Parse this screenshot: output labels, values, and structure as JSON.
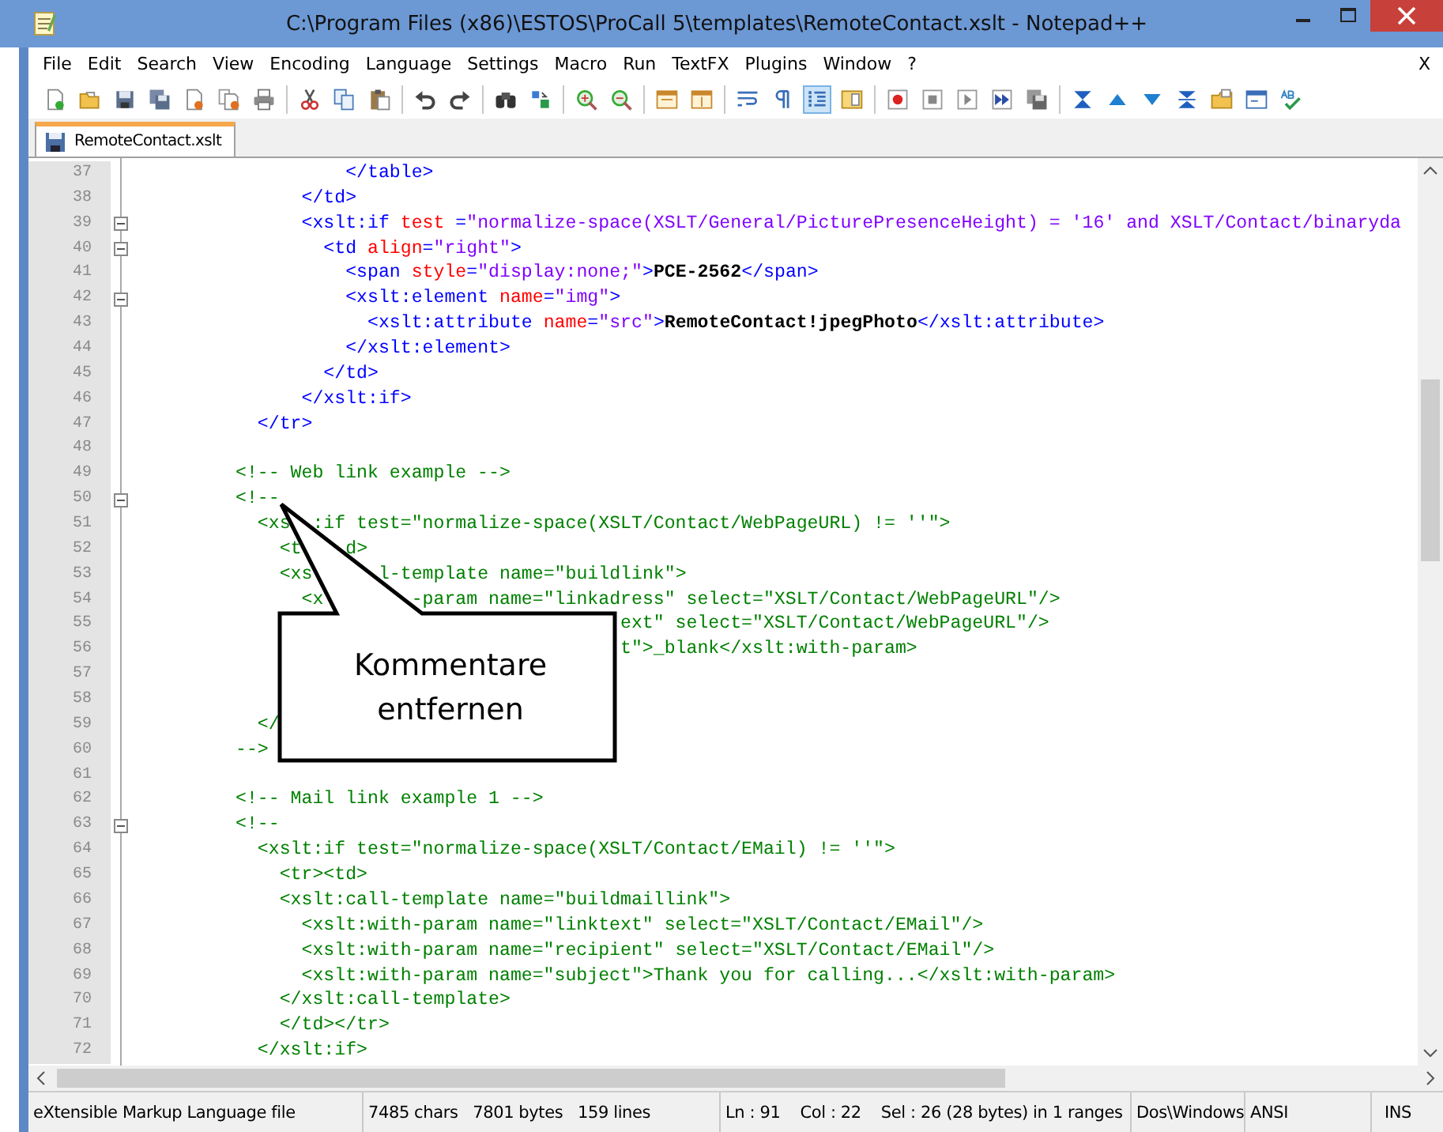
{
  "window": {
    "title": "C:\\Program Files (x86)\\ESTOS\\ProCall 5\\templates\\RemoteContact.xslt - Notepad++"
  },
  "menu": [
    "File",
    "Edit",
    "Search",
    "View",
    "Encoding",
    "Language",
    "Settings",
    "Macro",
    "Run",
    "TextFX",
    "Plugins",
    "Window",
    "?"
  ],
  "menu_close": "X",
  "toolbar": [
    {
      "kind": "new",
      "pressed": false
    },
    {
      "kind": "open",
      "pressed": false
    },
    {
      "kind": "save",
      "pressed": false
    },
    {
      "kind": "saveall",
      "pressed": false
    },
    {
      "kind": "close",
      "pressed": false
    },
    {
      "kind": "closeall",
      "pressed": false
    },
    {
      "kind": "print",
      "pressed": false
    },
    {
      "kind": "sep"
    },
    {
      "kind": "cut",
      "pressed": false
    },
    {
      "kind": "copy",
      "pressed": false
    },
    {
      "kind": "paste",
      "pressed": false
    },
    {
      "kind": "sep"
    },
    {
      "kind": "undo",
      "pressed": false
    },
    {
      "kind": "redo",
      "pressed": false
    },
    {
      "kind": "sep"
    },
    {
      "kind": "find",
      "pressed": false
    },
    {
      "kind": "replace",
      "pressed": false
    },
    {
      "kind": "sep"
    },
    {
      "kind": "zoomin",
      "pressed": false
    },
    {
      "kind": "zoomout",
      "pressed": false
    },
    {
      "kind": "sep"
    },
    {
      "kind": "syncv",
      "pressed": false
    },
    {
      "kind": "synch",
      "pressed": false
    },
    {
      "kind": "sep"
    },
    {
      "kind": "wrap",
      "pressed": false
    },
    {
      "kind": "pilcrow",
      "pressed": false
    },
    {
      "kind": "indent",
      "pressed": true
    },
    {
      "kind": "docmap",
      "pressed": false
    },
    {
      "kind": "sep"
    },
    {
      "kind": "record",
      "pressed": false
    },
    {
      "kind": "stop",
      "pressed": false
    },
    {
      "kind": "play",
      "pressed": false
    },
    {
      "kind": "playmulti",
      "pressed": false
    },
    {
      "kind": "savemacro",
      "pressed": false
    },
    {
      "kind": "sep"
    },
    {
      "kind": "foldall",
      "pressed": false
    },
    {
      "kind": "up",
      "pressed": false
    },
    {
      "kind": "down",
      "pressed": false
    },
    {
      "kind": "unfoldall",
      "pressed": false
    },
    {
      "kind": "folder",
      "pressed": false
    },
    {
      "kind": "panel",
      "pressed": false
    },
    {
      "kind": "spell",
      "pressed": false
    }
  ],
  "tabs": [
    {
      "label": "RemoteContact.xslt",
      "selected": true
    }
  ],
  "editor": {
    "lines": [
      {
        "number": "37",
        "foldable": false,
        "segments": [
          {
            "kind": "tag",
            "text": "          </table>"
          }
        ]
      },
      {
        "number": "38",
        "foldable": false,
        "segments": [
          {
            "kind": "tag",
            "text": "      </td>"
          }
        ]
      },
      {
        "number": "39",
        "foldable": true,
        "segments": [
          {
            "kind": "tag",
            "text": "      <xslt:if"
          },
          {
            "kind": "attr",
            "text": " test"
          },
          {
            "kind": "tag",
            "text": " ="
          },
          {
            "kind": "string",
            "text": "\"normalize-space(XSLT/General/PicturePresenceHeight) = '16' and XSLT/Contact/binaryda"
          }
        ]
      },
      {
        "number": "40",
        "foldable": true,
        "segments": [
          {
            "kind": "tag",
            "text": "        <td"
          },
          {
            "kind": "attr",
            "text": " align"
          },
          {
            "kind": "tag",
            "text": "="
          },
          {
            "kind": "string",
            "text": "\"right\""
          },
          {
            "kind": "tag",
            "text": ">"
          }
        ]
      },
      {
        "number": "41",
        "foldable": false,
        "segments": [
          {
            "kind": "tag",
            "text": "          <span"
          },
          {
            "kind": "attr",
            "text": " style"
          },
          {
            "kind": "tag",
            "text": "="
          },
          {
            "kind": "string",
            "text": "\"display:none;\""
          },
          {
            "kind": "tag",
            "text": ">"
          },
          {
            "kind": "text",
            "text": "PCE-2562"
          },
          {
            "kind": "tag",
            "text": "</span>"
          }
        ]
      },
      {
        "number": "42",
        "foldable": true,
        "segments": [
          {
            "kind": "tag",
            "text": "          <xslt:element"
          },
          {
            "kind": "attr",
            "text": " name"
          },
          {
            "kind": "tag",
            "text": "="
          },
          {
            "kind": "string",
            "text": "\"img\""
          },
          {
            "kind": "tag",
            "text": ">"
          }
        ]
      },
      {
        "number": "43",
        "foldable": false,
        "segments": [
          {
            "kind": "tag",
            "text": "            <xslt:attribute"
          },
          {
            "kind": "attr",
            "text": " name"
          },
          {
            "kind": "tag",
            "text": "="
          },
          {
            "kind": "string",
            "text": "\"src\""
          },
          {
            "kind": "tag",
            "text": ">"
          },
          {
            "kind": "text",
            "text": "RemoteContact!jpegPhoto"
          },
          {
            "kind": "tag",
            "text": "</xslt:attribute>"
          }
        ]
      },
      {
        "number": "44",
        "foldable": false,
        "segments": [
          {
            "kind": "tag",
            "text": "          </xslt:element>"
          }
        ]
      },
      {
        "number": "45",
        "foldable": false,
        "segments": [
          {
            "kind": "tag",
            "text": "        </td>"
          }
        ]
      },
      {
        "number": "46",
        "foldable": false,
        "segments": [
          {
            "kind": "tag",
            "text": "      </xslt:if>"
          }
        ]
      },
      {
        "number": "47",
        "foldable": false,
        "segments": [
          {
            "kind": "tag",
            "text": "  </tr>"
          }
        ]
      },
      {
        "number": "48",
        "foldable": false
      },
      {
        "number": "49",
        "foldable": false,
        "segments": [
          {
            "kind": "comment",
            "text": "<!-- Web link example -->"
          }
        ]
      },
      {
        "number": "50",
        "foldable": true,
        "segments": [
          {
            "kind": "comment",
            "text": "<!--"
          }
        ]
      },
      {
        "number": "51",
        "foldable": false,
        "segments": [
          {
            "kind": "comment",
            "text": "  <xs  :if test=\"normalize-space(XSLT/Contact/WebPageURL) != ''\">"
          }
        ]
      },
      {
        "number": "52",
        "foldable": false,
        "segments": [
          {
            "kind": "comment",
            "text": "    <t    d>"
          }
        ]
      },
      {
        "number": "53",
        "foldable": false,
        "segments": [
          {
            "kind": "comment",
            "text": "    <xs      l-template name=\"buildlink\">"
          }
        ]
      },
      {
        "number": "54",
        "foldable": false,
        "segments": [
          {
            "kind": "comment",
            "text": "      <x        -param name=\"linkadress\" select=\"XSLT/Contact/WebPageURL\"/>"
          }
        ]
      },
      {
        "number": "55",
        "foldable": false,
        "segments": [
          {
            "kind": "comment",
            "text": "                                   ext\" select=\"XSLT/Contact/WebPageURL\"/>"
          }
        ]
      },
      {
        "number": "56",
        "foldable": false,
        "segments": [
          {
            "kind": "comment",
            "text": "                                   t\">_blank</xslt:with-param>"
          }
        ]
      },
      {
        "number": "57",
        "foldable": false
      },
      {
        "number": "58",
        "foldable": false
      },
      {
        "number": "59",
        "foldable": false,
        "segments": [
          {
            "kind": "comment",
            "text": "  </"
          }
        ]
      },
      {
        "number": "60",
        "foldable": false,
        "segments": [
          {
            "kind": "comment",
            "text": "-->"
          }
        ]
      },
      {
        "number": "61",
        "foldable": false
      },
      {
        "number": "62",
        "foldable": false,
        "segments": [
          {
            "kind": "comment",
            "text": "<!-- Mail link example 1 -->"
          }
        ]
      },
      {
        "number": "63",
        "foldable": true,
        "segments": [
          {
            "kind": "comment",
            "text": "<!--"
          }
        ]
      },
      {
        "number": "64",
        "foldable": false,
        "segments": [
          {
            "kind": "comment",
            "text": "  <xslt:if test=\"normalize-space(XSLT/Contact/EMail) != ''\">"
          }
        ]
      },
      {
        "number": "65",
        "foldable": false,
        "segments": [
          {
            "kind": "comment",
            "text": "    <tr><td>"
          }
        ]
      },
      {
        "number": "66",
        "foldable": false,
        "segments": [
          {
            "kind": "comment",
            "text": "    <xslt:call-template name=\"buildmaillink\">"
          }
        ]
      },
      {
        "number": "67",
        "foldable": false,
        "segments": [
          {
            "kind": "comment",
            "text": "      <xslt:with-param name=\"linktext\" select=\"XSLT/Contact/EMail\"/>"
          }
        ]
      },
      {
        "number": "68",
        "foldable": false,
        "segments": [
          {
            "kind": "comment",
            "text": "      <xslt:with-param name=\"recipient\" select=\"XSLT/Contact/EMail\"/>"
          }
        ]
      },
      {
        "number": "69",
        "foldable": false,
        "segments": [
          {
            "kind": "comment",
            "text": "      <xslt:with-param name=\"subject\">Thank you for calling...</xslt:with-param>"
          }
        ]
      },
      {
        "number": "70",
        "foldable": false,
        "segments": [
          {
            "kind": "comment",
            "text": "    </xslt:call-template>"
          }
        ]
      },
      {
        "number": "71",
        "foldable": false,
        "segments": [
          {
            "kind": "comment",
            "text": "    </td></tr>"
          }
        ]
      },
      {
        "number": "72",
        "foldable": false,
        "segments": [
          {
            "kind": "comment",
            "text": "  </xslt:if>"
          }
        ]
      }
    ]
  },
  "callout": {
    "text": "Kommentare entfernen"
  },
  "status_bar": [
    {
      "text": "eXtensible Markup Language file"
    },
    {
      "text": "7485 chars   7801 bytes   159 lines"
    },
    {
      "text": "Ln : 91    Col : 22    Sel : 26 (28 bytes) in 1 ranges"
    },
    {
      "text": "Dos\\Windows"
    },
    {
      "text": "ANSI"
    },
    {
      "text": "INS"
    }
  ]
}
